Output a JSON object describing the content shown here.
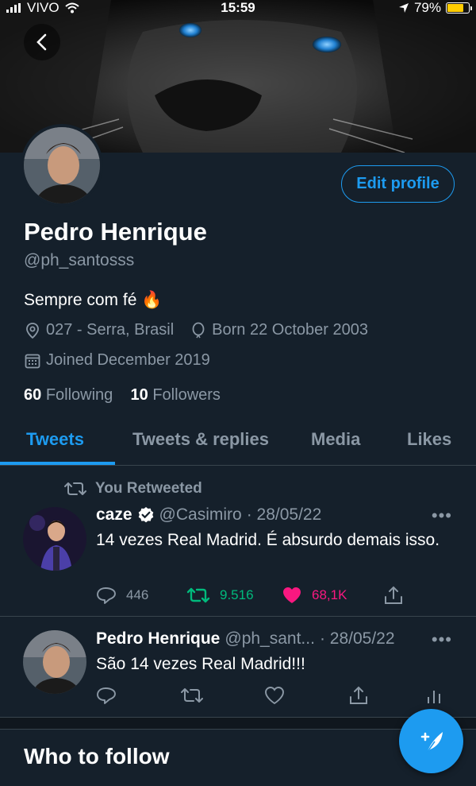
{
  "status": {
    "carrier": "VIVO",
    "time": "15:59",
    "battery": "79%",
    "battery_level": 0.79
  },
  "profile": {
    "name": "Pedro Henrique",
    "handle": "@ph_santosss",
    "bio": "Sempre com fé 🔥",
    "location": "027 - Serra, Brasil",
    "birthday": "Born 22 October 2003",
    "joined": "Joined December 2019",
    "following_count": "60",
    "following_label": "Following",
    "followers_count": "10",
    "followers_label": "Followers",
    "edit_label": "Edit profile"
  },
  "tabs": [
    {
      "label": "Tweets",
      "active": true
    },
    {
      "label": "Tweets & replies",
      "active": false
    },
    {
      "label": "Media",
      "active": false
    },
    {
      "label": "Likes",
      "active": false
    }
  ],
  "tweets": [
    {
      "retweet_label": "You Retweeted",
      "name": "caze",
      "handle": "@Casimiro",
      "date": "· 28/05/22",
      "text": "14 vezes Real Madrid. É absurdo demais isso.",
      "replies": "446",
      "retweets": "9.516",
      "likes": "68,1K"
    },
    {
      "name": "Pedro Henrique",
      "handle": "@ph_sant...",
      "date": "· 28/05/22",
      "text": "São 14 vezes Real Madrid!!!"
    }
  ],
  "section": {
    "who_to_follow": "Who to follow"
  },
  "colors": {
    "background": "#15202b",
    "accent": "#1d9bf0",
    "retweet_green": "#00ba7c",
    "like_pink": "#f91880",
    "muted": "#8b98a5"
  }
}
